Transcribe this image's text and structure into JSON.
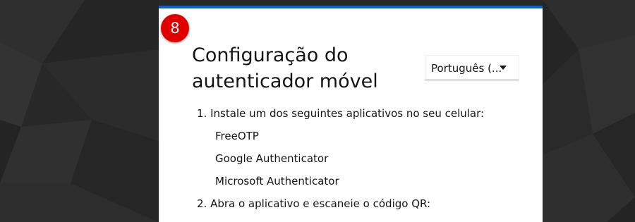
{
  "step_badge": "8",
  "page_title": "Configuração do autenticador móvel",
  "language_select": {
    "selected": "Português (..."
  },
  "instructions": {
    "step1_label": "1. Instale um dos seguintes aplicativos no seu celular:",
    "apps": [
      "FreeOTP",
      "Google Authenticator",
      "Microsoft Authenticator"
    ],
    "step2_label": "2. Abra o aplicativo e escaneie o código QR:"
  },
  "colors": {
    "card_top_border": "#0066cc",
    "badge": "#e00000",
    "background": "#2a2a2a"
  }
}
